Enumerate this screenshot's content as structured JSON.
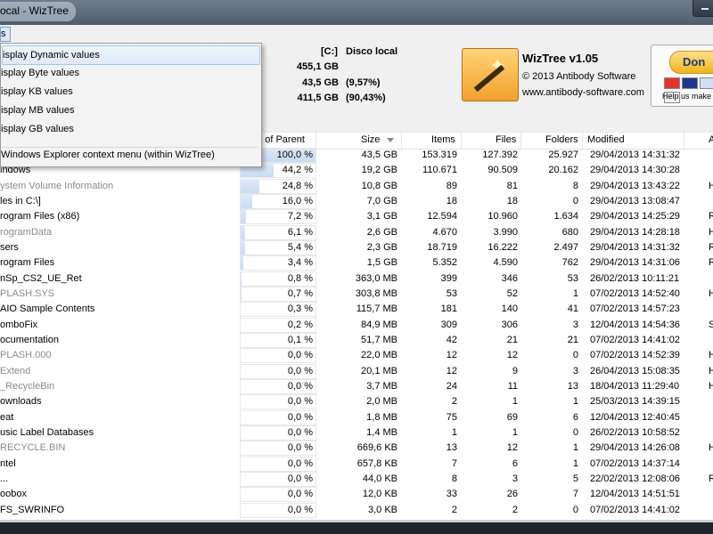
{
  "window": {
    "title": "ocal - WizTree"
  },
  "menubar": {
    "item_label": "s"
  },
  "drive": {
    "letter": "[C:]",
    "name": "Disco local",
    "total": "455,1 GB",
    "used": "43,5 GB",
    "used_pct": "(9,57%)",
    "free": "411,5 GB",
    "free_pct": "(90,43%)"
  },
  "brand": {
    "name": "WizTree v1.05",
    "copyright": "© 2013 Antibody Software",
    "url": "www.antibody-software.com"
  },
  "donate": {
    "label": "Don",
    "help": "Help us make"
  },
  "columns": {
    "percent": "nt of Parent",
    "size": "Size",
    "items": "Items",
    "files": "Files",
    "folders": "Folders",
    "modified": "Modified",
    "attrs": "A"
  },
  "dropdown": {
    "items": [
      "isplay Dynamic values",
      "isplay Byte values",
      "isplay KB values",
      "isplay MB values",
      "isplay GB values",
      "Windows Explorer context menu (within WizTree)"
    ]
  },
  "rows": [
    {
      "name": "",
      "pct": "100,0 %",
      "pctv": 100,
      "size": "43,5 GB",
      "items": "153.319",
      "files": "127.392",
      "folders": "25.927",
      "modified": "29/04/2013 14:31:32",
      "attr": "",
      "gray": false
    },
    {
      "name": "indows",
      "pct": "44,2 %",
      "pctv": 44.2,
      "size": "19,2 GB",
      "items": "110.671",
      "files": "90.509",
      "folders": "20.162",
      "modified": "29/04/2013 14:30:28",
      "attr": "",
      "gray": false
    },
    {
      "name": "ystem Volume Information",
      "pct": "24,8 %",
      "pctv": 24.8,
      "size": "10,8 GB",
      "items": "89",
      "files": "81",
      "folders": "8",
      "modified": "29/04/2013 13:43:22",
      "attr": "H",
      "gray": true
    },
    {
      "name": "les in C:\\]",
      "pct": "16,0 %",
      "pctv": 16.0,
      "size": "7,0 GB",
      "items": "18",
      "files": "18",
      "folders": "0",
      "modified": "29/04/2013 13:08:47",
      "attr": "",
      "gray": false
    },
    {
      "name": "rogram Files (x86)",
      "pct": "7,2 %",
      "pctv": 7.2,
      "size": "3,1 GB",
      "items": "12.594",
      "files": "10.960",
      "folders": "1.634",
      "modified": "29/04/2013 14:25:29",
      "attr": "R",
      "gray": false
    },
    {
      "name": "rogramData",
      "pct": "6,1 %",
      "pctv": 6.1,
      "size": "2,6 GB",
      "items": "4.670",
      "files": "3.990",
      "folders": "680",
      "modified": "29/04/2013 14:28:18",
      "attr": "H",
      "gray": true
    },
    {
      "name": "sers",
      "pct": "5,4 %",
      "pctv": 5.4,
      "size": "2,3 GB",
      "items": "18.719",
      "files": "16.222",
      "folders": "2.497",
      "modified": "29/04/2013 14:31:32",
      "attr": "R",
      "gray": false
    },
    {
      "name": "rogram Files",
      "pct": "3,4 %",
      "pctv": 3.4,
      "size": "1,5 GB",
      "items": "5.352",
      "files": "4.590",
      "folders": "762",
      "modified": "29/04/2013 14:31:06",
      "attr": "R",
      "gray": false
    },
    {
      "name": "nSp_CS2_UE_Ret",
      "pct": "0,8 %",
      "pctv": 0.8,
      "size": "363,0 MB",
      "items": "399",
      "files": "346",
      "folders": "53",
      "modified": "26/02/2013 10:11:21",
      "attr": "",
      "gray": false
    },
    {
      "name": "PLASH.SYS",
      "pct": "0,7 %",
      "pctv": 0.7,
      "size": "303,8 MB",
      "items": "53",
      "files": "52",
      "folders": "1",
      "modified": "07/02/2013 14:52:40",
      "attr": "H",
      "gray": true
    },
    {
      "name": "AIO Sample Contents",
      "pct": "0,3 %",
      "pctv": 0.3,
      "size": "115,7 MB",
      "items": "181",
      "files": "140",
      "folders": "41",
      "modified": "07/02/2013 14:57:23",
      "attr": "",
      "gray": false
    },
    {
      "name": "omboFix",
      "pct": "0,2 %",
      "pctv": 0.2,
      "size": "84,9 MB",
      "items": "309",
      "files": "306",
      "folders": "3",
      "modified": "12/04/2013 14:54:36",
      "attr": "S",
      "gray": false
    },
    {
      "name": "ocumentation",
      "pct": "0,1 %",
      "pctv": 0.1,
      "size": "51,7 MB",
      "items": "42",
      "files": "21",
      "folders": "21",
      "modified": "07/02/2013 14:41:02",
      "attr": "",
      "gray": false
    },
    {
      "name": "PLASH.000",
      "pct": "0,0 %",
      "pctv": 0,
      "size": "22,0 MB",
      "items": "12",
      "files": "12",
      "folders": "0",
      "modified": "07/02/2013 14:52:39",
      "attr": "H",
      "gray": true
    },
    {
      "name": "Extend",
      "pct": "0,0 %",
      "pctv": 0,
      "size": "20,1 MB",
      "items": "12",
      "files": "9",
      "folders": "3",
      "modified": "26/04/2013 15:08:35",
      "attr": "H",
      "gray": true
    },
    {
      "name": "_RecycleBin",
      "pct": "0,0 %",
      "pctv": 0,
      "size": "3,7 MB",
      "items": "24",
      "files": "11",
      "folders": "13",
      "modified": "18/04/2013 11:29:40",
      "attr": "H",
      "gray": true
    },
    {
      "name": "ownloads",
      "pct": "0,0 %",
      "pctv": 0,
      "size": "2,0 MB",
      "items": "2",
      "files": "1",
      "folders": "1",
      "modified": "25/03/2013 14:39:15",
      "attr": "",
      "gray": false
    },
    {
      "name": "eat",
      "pct": "0,0 %",
      "pctv": 0,
      "size": "1,8 MB",
      "items": "75",
      "files": "69",
      "folders": "6",
      "modified": "12/04/2013 12:40:45",
      "attr": "",
      "gray": false
    },
    {
      "name": "usic Label Databases",
      "pct": "0,0 %",
      "pctv": 0,
      "size": "1,4 MB",
      "items": "1",
      "files": "1",
      "folders": "0",
      "modified": "26/02/2013 10:58:52",
      "attr": "",
      "gray": false
    },
    {
      "name": "RECYCLE.BIN",
      "pct": "0,0 %",
      "pctv": 0,
      "size": "669,6 KB",
      "items": "13",
      "files": "12",
      "folders": "1",
      "modified": "29/04/2013 14:26:08",
      "attr": "H",
      "gray": true
    },
    {
      "name": "ntel",
      "pct": "0,0 %",
      "pctv": 0,
      "size": "657,8 KB",
      "items": "7",
      "files": "6",
      "folders": "1",
      "modified": "07/02/2013 14:37:14",
      "attr": "",
      "gray": false
    },
    {
      "name": "...",
      "pct": "0,0 %",
      "pctv": 0,
      "size": "44,0 KB",
      "items": "8",
      "files": "3",
      "folders": "5",
      "modified": "22/02/2013 12:08:06",
      "attr": "R",
      "gray": false
    },
    {
      "name": "oobox",
      "pct": "0,0 %",
      "pctv": 0,
      "size": "12,0 KB",
      "items": "33",
      "files": "26",
      "folders": "7",
      "modified": "12/04/2013 14:51:51",
      "attr": "",
      "gray": false
    },
    {
      "name": "FS_SWRINFO",
      "pct": "0,0 %",
      "pctv": 0,
      "size": "3,0 KB",
      "items": "2",
      "files": "2",
      "folders": "0",
      "modified": "07/02/2013 14:41:02",
      "attr": "",
      "gray": false
    }
  ],
  "colors": {
    "bar_fill": "#c8dcf4",
    "highlight": "#dfeaf7",
    "donate": "#f2b418"
  }
}
